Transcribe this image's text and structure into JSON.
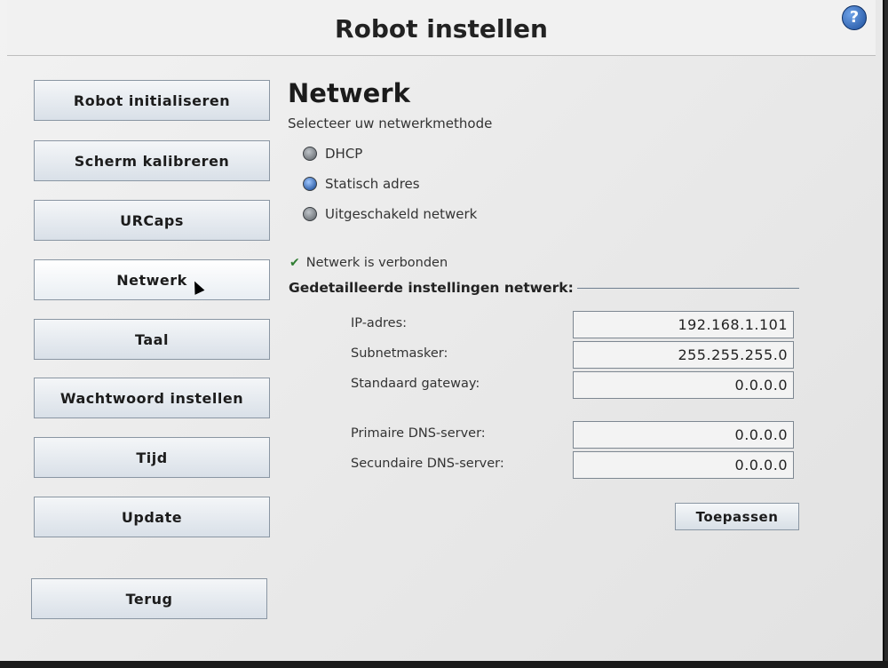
{
  "window": {
    "title": "Robot instellen",
    "help_icon": "question-mark-icon",
    "help_label": "?"
  },
  "sidebar": {
    "items": [
      {
        "label": "Robot initialiseren"
      },
      {
        "label": "Scherm kalibreren"
      },
      {
        "label": "URCaps"
      },
      {
        "label": "Netwerk"
      },
      {
        "label": "Taal"
      },
      {
        "label": "Wachtwoord instellen"
      },
      {
        "label": "Tijd"
      },
      {
        "label": "Update"
      },
      {
        "label": "Terug"
      }
    ],
    "active_index": 3
  },
  "network": {
    "heading": "Netwerk",
    "method_prompt": "Selecteer uw netwerkmethode",
    "methods": [
      {
        "label": "DHCP",
        "selected": false
      },
      {
        "label": "Statisch adres",
        "selected": true
      },
      {
        "label": "Uitgeschakeld netwerk",
        "selected": false
      }
    ],
    "status_icon": "check-icon",
    "status_text": "Netwerk is verbonden",
    "details_heading": "Gedetailleerde instellingen netwerk:",
    "fields": {
      "ip_label": "IP-adres:",
      "ip_value": "192.168.1.101",
      "subnet_label": "Subnetmasker:",
      "subnet_value": "255.255.255.0",
      "gateway_label": "Standaard gateway:",
      "gateway_value": "0.0.0.0",
      "dns1_label": "Primaire DNS-server:",
      "dns1_value": "0.0.0.0",
      "dns2_label": "Secundaire DNS-server:",
      "dns2_value": "0.0.0.0"
    },
    "apply_label": "Toepassen"
  },
  "colors": {
    "accent_blue": "#1d4f9c",
    "button_border": "#8a96a3",
    "status_green": "#2f7d32"
  }
}
